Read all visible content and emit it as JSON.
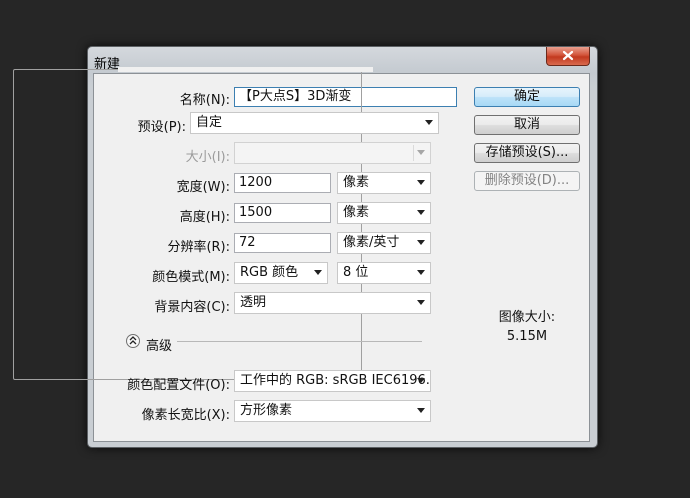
{
  "window": {
    "title": "新建"
  },
  "form": {
    "name": {
      "label": "名称(N):",
      "value": "【P大点S】3D渐变"
    },
    "preset": {
      "label": "预设(P):",
      "value": "自定"
    },
    "size": {
      "label": "大小(I):",
      "value": ""
    },
    "width": {
      "label": "宽度(W):",
      "value": "1200",
      "unit": "像素"
    },
    "height": {
      "label": "高度(H):",
      "value": "1500",
      "unit": "像素"
    },
    "resolution": {
      "label": "分辨率(R):",
      "value": "72",
      "unit": "像素/英寸"
    },
    "color_mode": {
      "label": "颜色模式(M):",
      "value": "RGB 颜色",
      "depth": "8 位"
    },
    "background": {
      "label": "背景内容(C):",
      "value": "透明"
    },
    "advanced": {
      "label": "高级"
    },
    "color_profile": {
      "label": "颜色配置文件(O):",
      "value": "工作中的 RGB: sRGB IEC6196..."
    },
    "pixel_aspect": {
      "label": "像素长宽比(X):",
      "value": "方形像素"
    }
  },
  "buttons": {
    "ok": "确定",
    "cancel": "取消",
    "save_preset": "存储预设(S)...",
    "delete_preset": "删除预设(D)..."
  },
  "image_size": {
    "label": "图像大小:",
    "value": "5.15M"
  },
  "colors": {
    "accent": "#3c7fb1",
    "close": "#c2391f"
  }
}
